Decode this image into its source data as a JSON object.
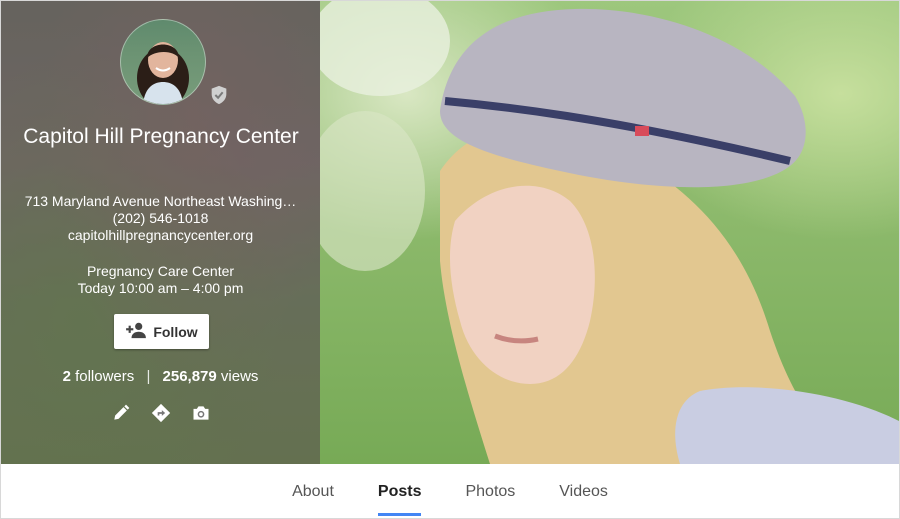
{
  "profile": {
    "name": "Capitol Hill Pregnancy Center",
    "address": "713 Maryland Avenue Northeast Washing…",
    "phone": "(202) 546-1018",
    "website": "capitolhillpregnancycenter.org",
    "category": "Pregnancy Care Center",
    "hours": "Today 10:00 am – 4:00 pm",
    "follow_label": "Follow",
    "followers_count": "2",
    "followers_label": "followers",
    "views_count": "256,879",
    "views_label": "views",
    "separator": "|"
  },
  "icons": {
    "verified": "verified-shield-icon",
    "follow": "person-add-icon",
    "edit": "pencil-icon",
    "directions": "directions-icon",
    "camera": "camera-icon"
  },
  "tabs": [
    {
      "label": "About"
    },
    {
      "label": "Posts",
      "active": true
    },
    {
      "label": "Photos"
    },
    {
      "label": "Videos"
    }
  ],
  "colors": {
    "accent": "#4285f4"
  }
}
